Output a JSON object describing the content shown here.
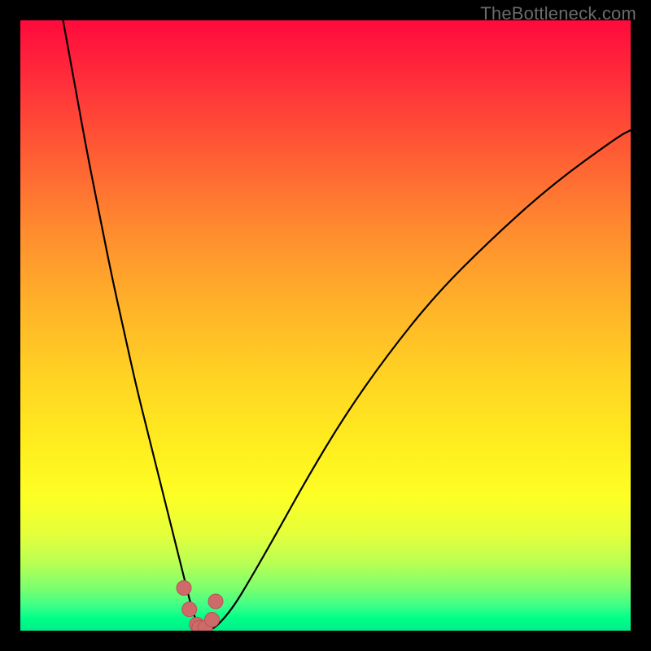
{
  "watermark": "TheBottleneck.com",
  "colors": {
    "curve_stroke": "#000000",
    "marker_fill": "#cf6a6a",
    "marker_stroke": "#b65454",
    "gradient_top": "#ff0a3c",
    "gradient_bottom": "#00ee8a",
    "page_background": "#000000"
  },
  "chart_data": {
    "type": "line",
    "title": "",
    "xlabel": "",
    "ylabel": "",
    "xlim": [
      0,
      100
    ],
    "ylim": [
      0,
      100
    ],
    "grid": false,
    "annotations": [
      "TheBottleneck.com"
    ],
    "series": [
      {
        "name": "bottleneck-curve",
        "x": [
          7,
          9,
          11,
          13,
          15,
          17,
          19,
          21,
          23,
          25,
          26,
          27,
          28,
          29,
          30,
          31,
          32.5,
          35,
          38,
          42,
          47,
          53,
          60,
          68,
          77,
          87,
          98,
          100
        ],
        "y": [
          100,
          89,
          78,
          68,
          58,
          49,
          40,
          32,
          24,
          16,
          12,
          8,
          4,
          1,
          0,
          0,
          1,
          4,
          9,
          16,
          25,
          35,
          45,
          55,
          64,
          73,
          81,
          82
        ]
      }
    ],
    "markers": {
      "name": "bottom-cluster",
      "x": [
        26.8,
        27.7,
        28.9,
        29.3,
        30.3,
        31.4,
        32.0
      ],
      "y": [
        7.0,
        3.5,
        1.0,
        0.5,
        0.5,
        1.8,
        4.8
      ]
    }
  }
}
